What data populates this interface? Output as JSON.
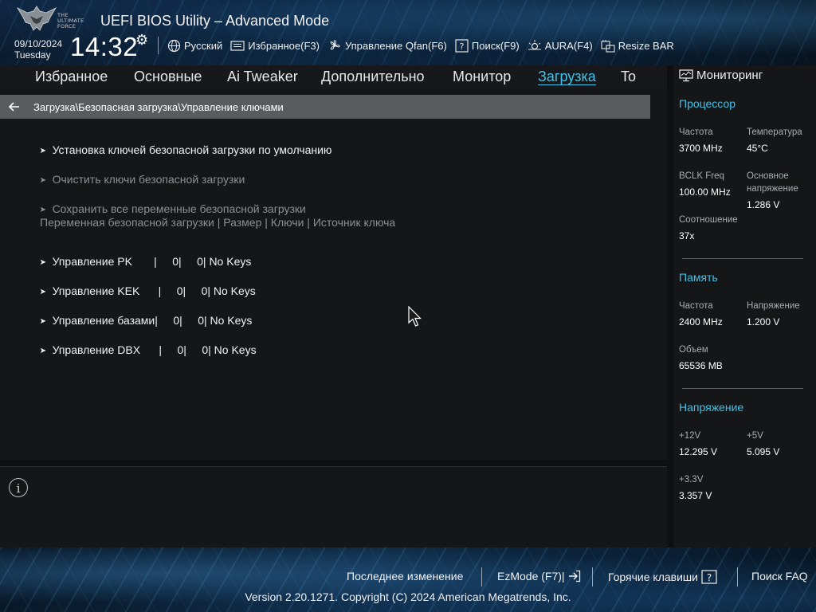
{
  "header": {
    "logo_text": [
      "THE",
      "ULTIMATE",
      "FORCE"
    ],
    "title": "UEFI BIOS Utility – Advanced Mode",
    "date": "09/10/2024",
    "day": "Tuesday",
    "time": "14:32",
    "toolbar": {
      "language": "Русский",
      "favorites": "Избранное(F3)",
      "qfan": "Управление Qfan(F6)",
      "search": "Поиск(F9)",
      "aura": "AURA(F4)",
      "resize_bar": "Resize BAR"
    }
  },
  "tabs": [
    "Избранное",
    "Основные",
    "Ai Tweaker",
    "Дополнительно",
    "Монитор",
    "Загрузка",
    "To"
  ],
  "active_tab": "Загрузка",
  "breadcrumb": "Загрузка\\Безопасная загрузка\\Управление ключами",
  "main": {
    "items": [
      {
        "label": "Установка ключей безопасной загрузки по умолчанию"
      },
      {
        "label": "Очистить ключи безопасной загрузки"
      },
      {
        "label": "Сохранить все переменные безопасной загрузки"
      }
    ],
    "table_header": "Переменная безопасной загрузки | Размер | Ключи | Источник ключа",
    "key_rows": [
      {
        "label": "Управление PK       |     0|     0| No Keys"
      },
      {
        "label": "Управление KEK      |     0|     0| No Keys"
      },
      {
        "label": "Управление базами|     0|     0| No Keys"
      },
      {
        "label": "Управление DBX      |     0|     0| No Keys"
      }
    ]
  },
  "monitor": {
    "title": "Мониторинг",
    "cpu": {
      "section": "Процессор",
      "freq_label": "Частота",
      "freq_value": "3700 MHz",
      "temp_label": "Температура",
      "temp_value": "45°C",
      "bclk_label": "BCLK Freq",
      "bclk_value": "100.00 MHz",
      "vcore_label_1": "Основное",
      "vcore_label_2": "напряжение",
      "vcore_value": "1.286 V",
      "ratio_label": "Соотношение",
      "ratio_value": "37x"
    },
    "memory": {
      "section": "Память",
      "freq_label": "Частота",
      "freq_value": "2400 MHz",
      "volt_label": "Напряжение",
      "volt_value": "1.200 V",
      "cap_label": "Объем",
      "cap_value": "65536 MB"
    },
    "voltage": {
      "section": "Напряжение",
      "v12_label": "+12V",
      "v12_value": "12.295 V",
      "v5_label": "+5V",
      "v5_value": "5.095 V",
      "v33_label": "+3.3V",
      "v33_value": "3.357 V"
    }
  },
  "footer": {
    "last_change": "Последнее изменение",
    "ezmode": "EzMode (F7)|",
    "hotkeys": "Горячие клавиши",
    "faq": "Поиск FAQ",
    "copyright": "Version 2.20.1271. Copyright (C) 2024 American Megatrends, Inc."
  },
  "colors": {
    "accent": "#3ec3ea",
    "breadcrumb_bg": "#595b5e",
    "panel_bg": "#141618"
  }
}
